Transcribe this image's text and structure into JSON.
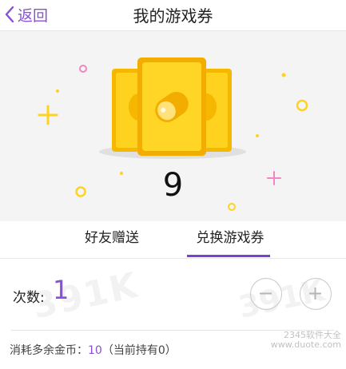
{
  "header": {
    "back_label": "返回",
    "title": "我的游戏券"
  },
  "hero": {
    "ticket_count": "9"
  },
  "tabs": [
    {
      "label": "好友赠送",
      "active": false
    },
    {
      "label": "兑换游戏券",
      "active": true
    }
  ],
  "exchange": {
    "quantity_label": "次数:",
    "quantity_value": "1",
    "cost_prefix": "消耗多余金币：",
    "cost_amount": "10",
    "cost_suffix": "（当前持有0）"
  },
  "watermarks": {
    "center": "391K",
    "right": "391K",
    "corner_line1": "2345软件大全",
    "corner_line2": "www.duote.com"
  },
  "colors": {
    "accent": "#7b3fd6",
    "ticket_yellow": "#ffd21f",
    "ticket_border": "#f0a800"
  },
  "icons": {
    "back": "chevron-left-icon",
    "minus": "minus-circle-icon",
    "plus": "plus-circle-icon"
  }
}
